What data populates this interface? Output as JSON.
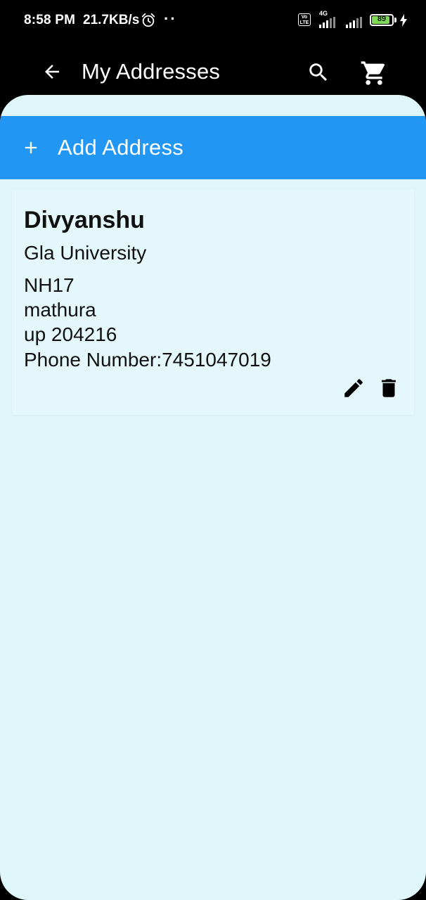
{
  "status_bar": {
    "time": "8:58 PM",
    "network_speed": "21.7KB/s",
    "dots": "··",
    "volte_label": "Vo LTE",
    "network_type": "4G",
    "battery_level": "89",
    "battery_fraction": 0.89,
    "icons": [
      "alarm-icon",
      "volte-icon",
      "signal-icon",
      "battery-icon",
      "charging-icon"
    ]
  },
  "app_bar": {
    "title": "My Addresses",
    "icons": [
      "back-arrow-icon",
      "search-icon",
      "cart-icon"
    ]
  },
  "actions": {
    "add_address_label": "Add Address",
    "add_icon": "plus-icon"
  },
  "addresses": [
    {
      "name": "Divyanshu",
      "line1": "Gla University",
      "line2": "NH17",
      "city": "mathura",
      "state_pin": "up 204216",
      "phone_label": "Phone Number:",
      "phone": "7451047019",
      "icons": [
        "edit-icon",
        "delete-icon"
      ]
    }
  ],
  "colors": {
    "primary": "#2196f3",
    "background": "#dff6f8",
    "card": "#e4f7fa",
    "app_bar": "#000000",
    "battery": "#7ed957"
  }
}
